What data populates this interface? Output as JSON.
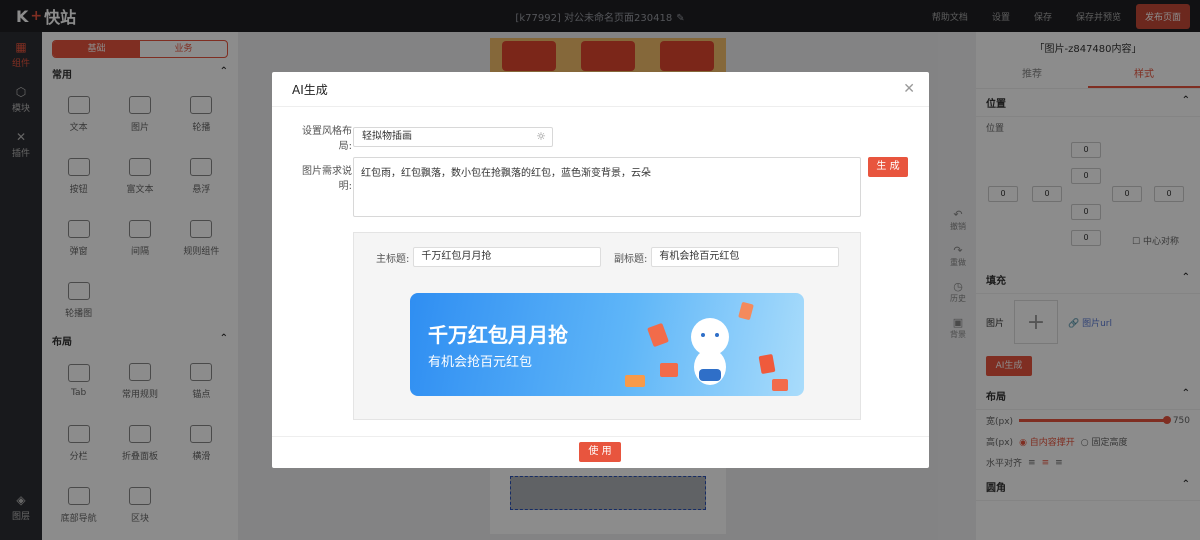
{
  "app": {
    "logo_mark": "K",
    "logo_plus": "+",
    "logo_text": "快站",
    "doc_title": "[k77992] 对公未命名页面230418"
  },
  "top_actions": [
    "帮助文档",
    "设置",
    "保存",
    "保存并预览",
    "发布页面"
  ],
  "leftbar": {
    "items": [
      {
        "icon": "grid-icon",
        "label": "组件"
      },
      {
        "icon": "cube-icon",
        "label": "模块"
      },
      {
        "icon": "tools-icon",
        "label": "插件"
      }
    ],
    "bottom": {
      "icon": "layers-icon",
      "label": "图层"
    }
  },
  "component_panel": {
    "segments": [
      "基础",
      "业务"
    ],
    "common_title": "常用",
    "common_items": [
      "文本",
      "图片",
      "轮播",
      "按钮",
      "富文本",
      "悬浮",
      "弹窗",
      "间隔",
      "规则组件",
      "轮播图"
    ],
    "layout_title": "布局",
    "layout_items": [
      "Tab",
      "常用规则",
      "锚点",
      "分栏",
      "折叠面板",
      "横滑",
      "底部导航",
      "区块"
    ]
  },
  "canvas_tools": [
    {
      "icon": "undo-icon",
      "label": "撤销"
    },
    {
      "icon": "redo-icon",
      "label": "重做"
    },
    {
      "icon": "clock-icon",
      "label": "历史"
    },
    {
      "icon": "background-icon",
      "label": "背景"
    }
  ],
  "right_panel": {
    "title": "「图片-z847480内容」",
    "tabs": [
      "推荐",
      "样式"
    ],
    "active_tab": 1,
    "position_title": "位置",
    "position_label": "位置",
    "position_values": [
      "0",
      "0",
      "0",
      "0",
      "0",
      "0",
      "0",
      "0"
    ],
    "center_label": "中心对称",
    "fill_title": "填充",
    "image_label": "图片",
    "image_url_link": "图片url",
    "ai_button": "AI生成",
    "layout_title": "布局",
    "width_label": "宽(px)",
    "width_value": "750",
    "height_label": "高(px)",
    "height_opt1": "自内容撑开",
    "height_opt2": "固定高度",
    "align_label": "水平对齐",
    "corner_title": "圆角"
  },
  "modal": {
    "title": "AI生成",
    "style_label": "设置风格布局:",
    "style_value": "轻拟物插画",
    "desc_label": "图片需求说明:",
    "desc_value": "红包雨，红包飘落，数小包在抢飘落的红包，蓝色渐变背景，云朵",
    "generate_button": "生 成",
    "main_title_label": "主标题:",
    "main_title_value": "千万红包月月抢",
    "sub_title_label": "副标题:",
    "sub_title_value": "有机会抢百元红包",
    "banner_title": "千万红包月月抢",
    "banner_subtitle": "有机会抢百元红包",
    "use_button": "使 用"
  },
  "colors": {
    "accent": "#e8553e",
    "topbar": "#1f2024",
    "banner_start": "#2f8ef2",
    "banner_end": "#a9dcfb"
  }
}
